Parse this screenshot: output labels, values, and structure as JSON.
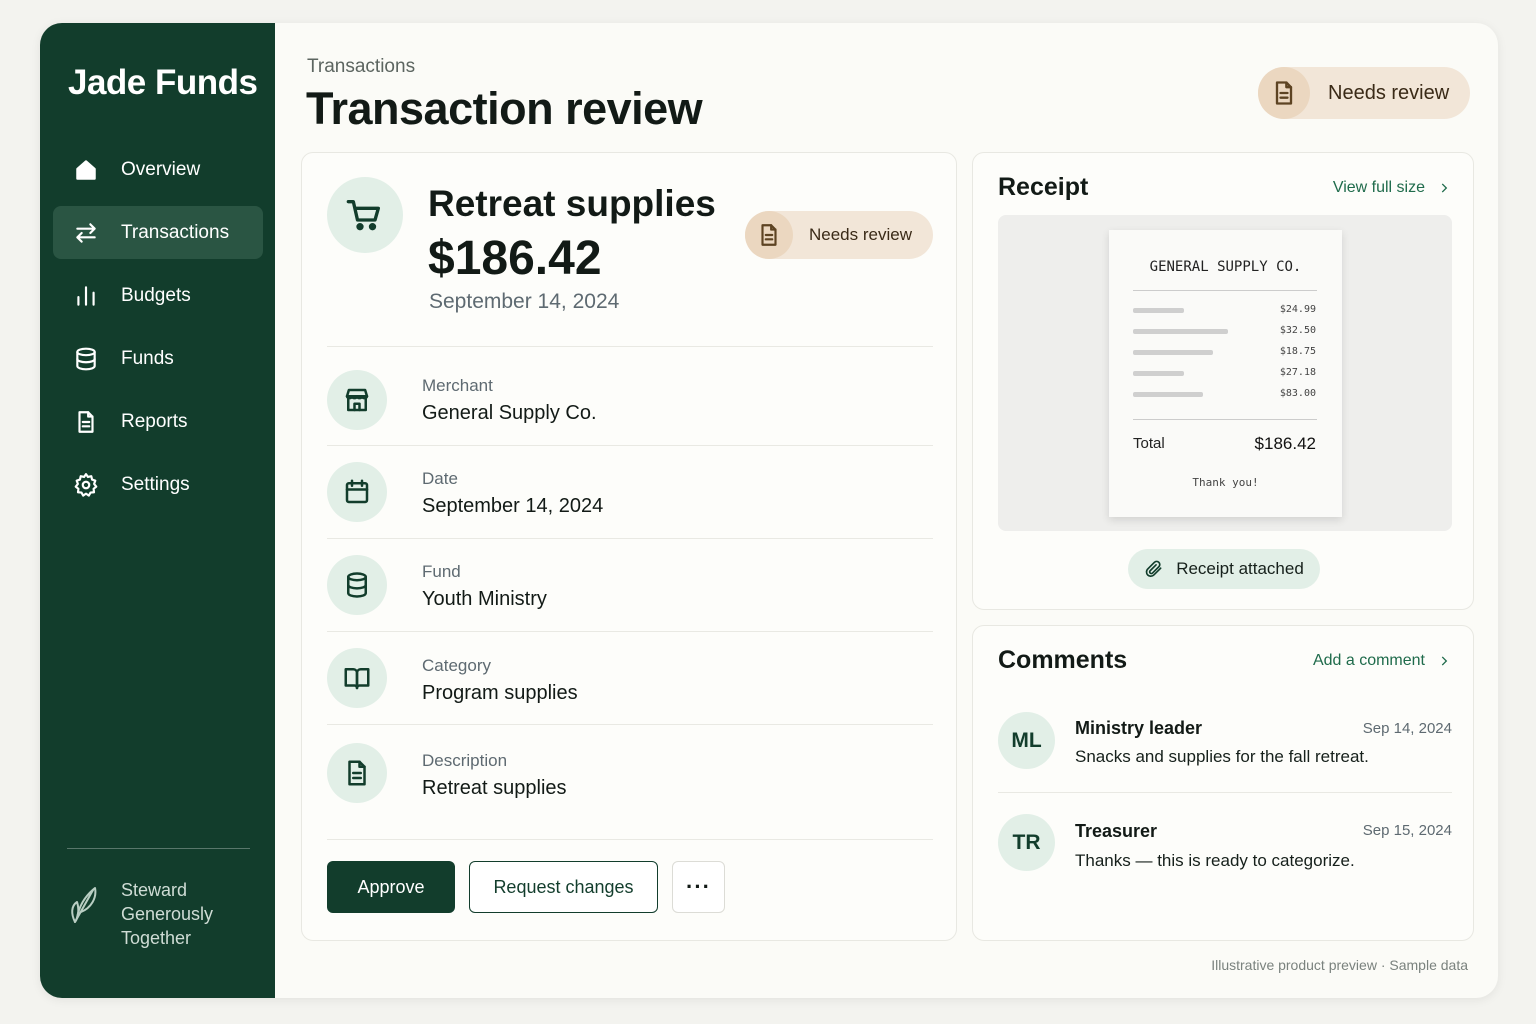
{
  "app": {
    "brand": "Jade Funds"
  },
  "sidebar": {
    "items": [
      {
        "label": "Overview",
        "icon": "home-icon",
        "active": false
      },
      {
        "label": "Transactions",
        "icon": "transfer-arrows-icon",
        "active": true
      },
      {
        "label": "Budgets",
        "icon": "bar-chart-icon",
        "active": false
      },
      {
        "label": "Funds",
        "icon": "database-icon",
        "active": false
      },
      {
        "label": "Reports",
        "icon": "document-icon",
        "active": false
      },
      {
        "label": "Settings",
        "icon": "gear-icon",
        "active": false
      }
    ],
    "tagline": "Steward Generously Together",
    "tagline_icon": "leaf-icon"
  },
  "header": {
    "breadcrumb": "Transactions",
    "title": "Transaction review",
    "status_badge": "Needs review",
    "status_icon": "document-icon"
  },
  "transaction": {
    "name": "Retreat supplies",
    "amount": "$186.42",
    "date": "September 14, 2024",
    "status": "Needs review",
    "icon": "shopping-cart-icon",
    "details": [
      {
        "label": "Merchant",
        "value": "General Supply Co.",
        "icon": "storefront-icon"
      },
      {
        "label": "Date",
        "value": "September 14, 2024",
        "icon": "calendar-icon"
      },
      {
        "label": "Fund",
        "value": "Youth Ministry",
        "icon": "database-icon"
      },
      {
        "label": "Category",
        "value": "Program supplies",
        "icon": "book-icon"
      },
      {
        "label": "Description",
        "value": "Retreat supplies",
        "icon": "document-icon"
      }
    ]
  },
  "actions": {
    "approve": "Approve",
    "request_changes": "Request changes",
    "more": "···"
  },
  "receipt": {
    "title": "Receipt",
    "view_link": "View full size",
    "paper": {
      "merchant": "GENERAL SUPPLY CO.",
      "prices": [
        "$24.99",
        "$32.50",
        "$18.75",
        "$27.18",
        "$83.00"
      ],
      "total_label": "Total",
      "total_value": "$186.42",
      "thanks": "Thank you!"
    },
    "attached_label": "Receipt attached",
    "attached_icon": "paperclip-icon"
  },
  "comments": {
    "title": "Comments",
    "add_link": "Add a comment",
    "items": [
      {
        "initials": "ML",
        "author": "Ministry leader",
        "date": "Sep 14, 2024",
        "text": "Snacks and supplies for the fall retreat."
      },
      {
        "initials": "TR",
        "author": "Treasurer",
        "date": "Sep 15, 2024",
        "text": "Thanks — this is ready to categorize."
      }
    ]
  },
  "footer": {
    "note": "Illustrative product preview · Sample data"
  },
  "colors": {
    "sidebar_bg": "#123d2c",
    "accent": "#123d2c",
    "link": "#1f6b4b",
    "badge_bg": "#f2e6d8",
    "icon_circle_bg": "#e2efe7"
  }
}
